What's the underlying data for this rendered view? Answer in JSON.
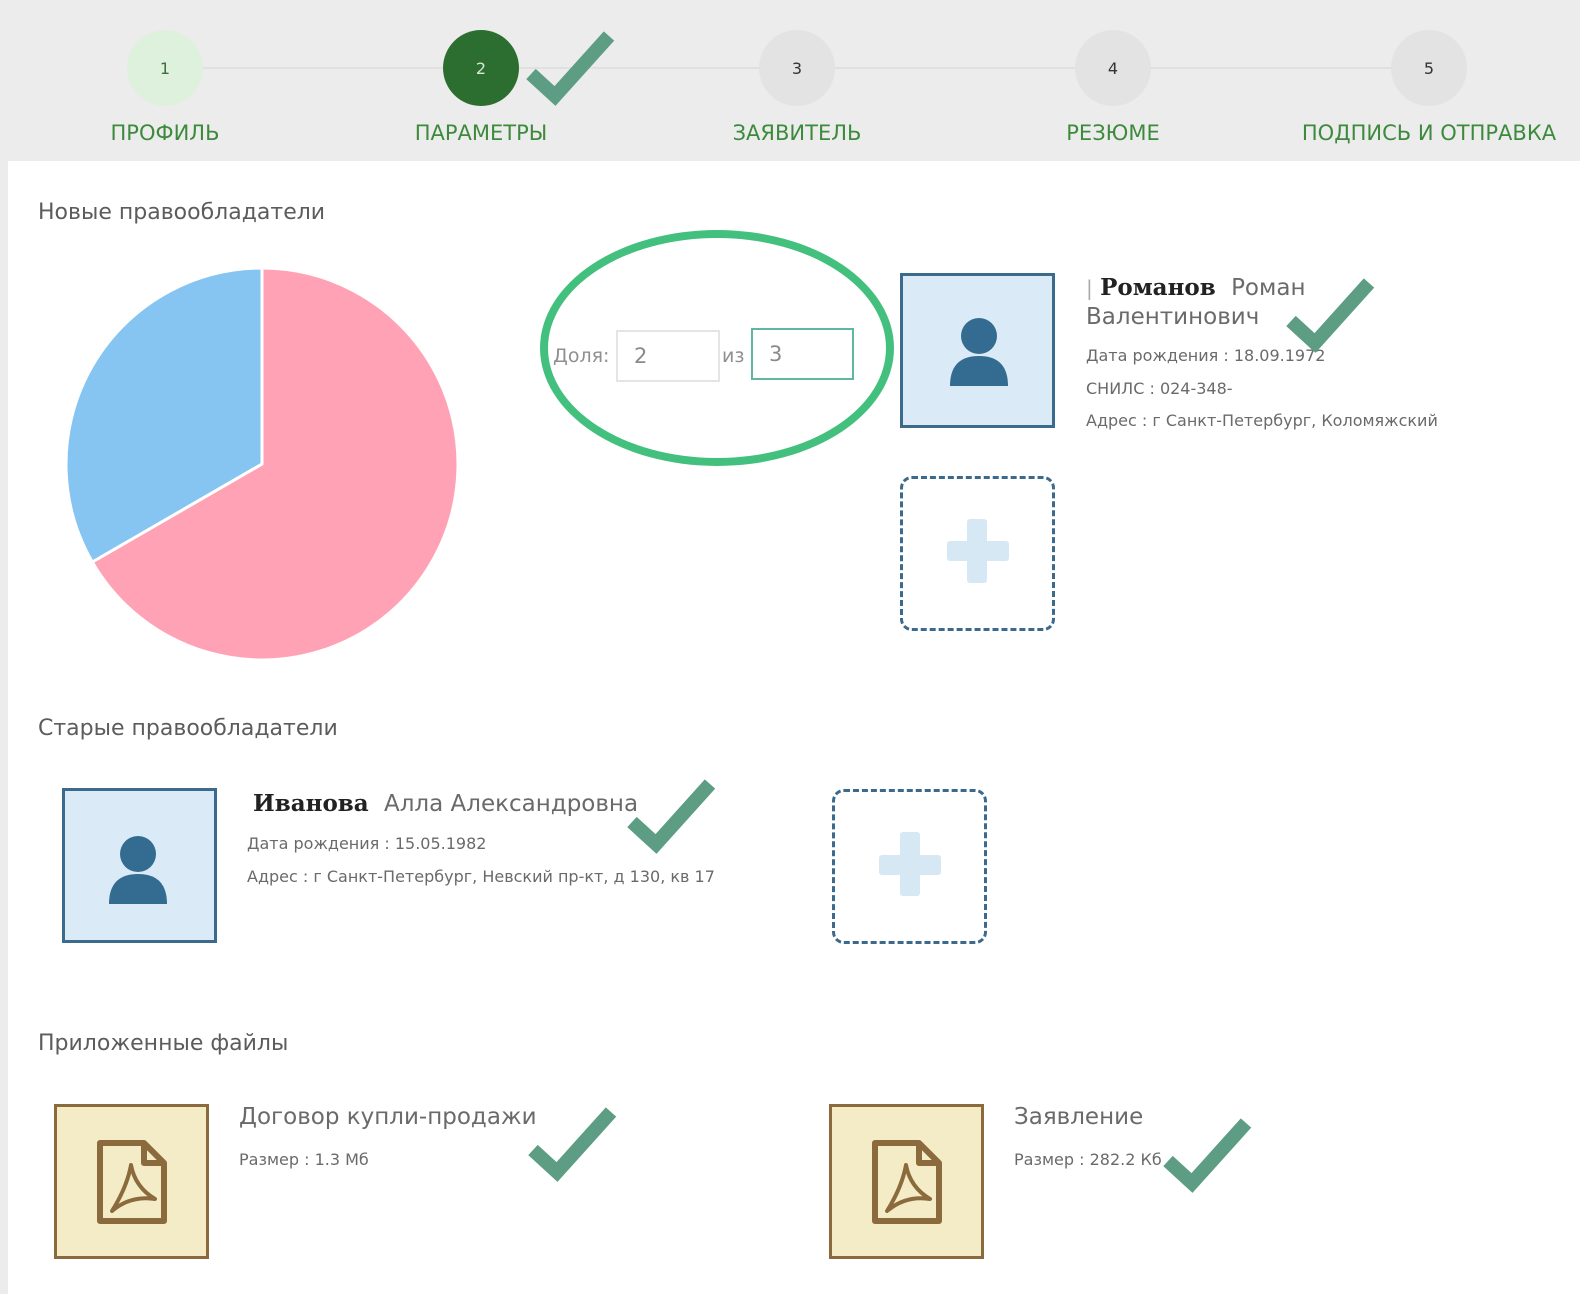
{
  "stepper": {
    "steps": [
      {
        "number": "1",
        "label": "ПРОФИЛЬ",
        "state": "done"
      },
      {
        "number": "2",
        "label": "ПАРАМЕТРЫ",
        "state": "active"
      },
      {
        "number": "3",
        "label": "ЗАЯВИТЕЛЬ",
        "state": "pending"
      },
      {
        "number": "4",
        "label": "РЕЗЮМЕ",
        "state": "pending"
      },
      {
        "number": "5",
        "label": "ПОДПИСЬ И ОТПРАВКА",
        "state": "pending"
      }
    ]
  },
  "new_owners": {
    "title": "Новые правообладатели",
    "share": {
      "label": "Доля:",
      "numerator": "2",
      "of_label": "из",
      "denominator": "3"
    },
    "person": {
      "prefix": "|",
      "surname": "Романов",
      "first_name": "Роман",
      "patronymic": "Валентинович",
      "birth": "Дата рождения : 18.09.1972",
      "snils": "СНИЛС : 024-348-",
      "address": "Адрес : г Санкт-Петербург, Коломяжский"
    }
  },
  "old_owners": {
    "title": "Старые правообладатели",
    "person": {
      "surname": "Иванова",
      "name_rest": "Алла Александровна",
      "birth": "Дата рождения : 15.05.1982",
      "address": "Адрес : г Санкт-Петербург, Невский пр-кт, д 130, кв 17"
    }
  },
  "files": {
    "title": "Приложенные файлы",
    "items": [
      {
        "name": "Договор купли-продажи",
        "size": "Размер : 1.3 Мб"
      },
      {
        "name": "Заявление",
        "size": "Размер : 282.2 Кб"
      }
    ]
  },
  "chart_data": {
    "type": "pie",
    "values": [
      2,
      1
    ],
    "colors": [
      "#ffa2b5",
      "#86c4f2"
    ]
  },
  "colors": {
    "accent_green": "#3d8a3d",
    "check_green": "#5c9d84",
    "ring_green": "#44c07e",
    "avatar_blue": "#3c6a8c"
  }
}
